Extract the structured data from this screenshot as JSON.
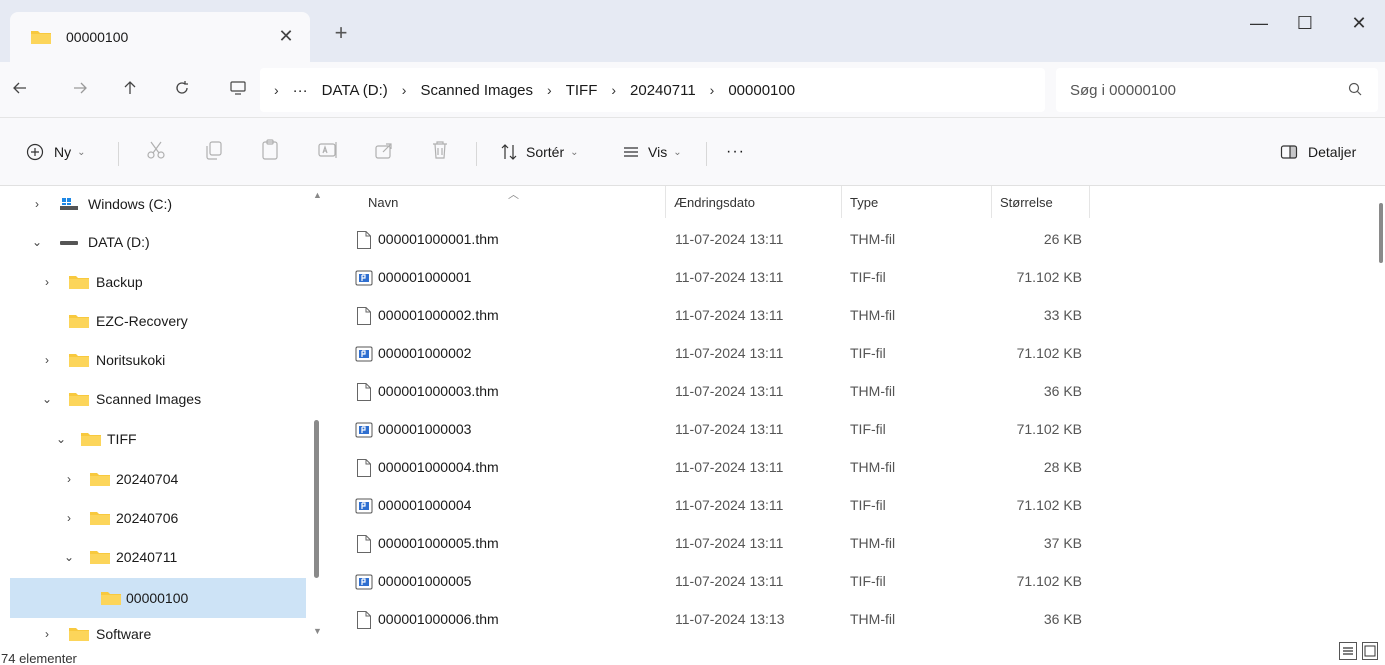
{
  "tab": {
    "title": "00000100",
    "close": "✕",
    "new": "+"
  },
  "window": {
    "minimize": "—",
    "maximize": "☐",
    "close": "✕"
  },
  "address": {
    "crumbs": [
      "DATA (D:)",
      "Scanned Images",
      "TIFF",
      "20240711",
      "00000100"
    ],
    "ellipsis": "···",
    "separator": "›"
  },
  "search": {
    "placeholder": "Søg i 00000100"
  },
  "commands": {
    "new_label": "Ny",
    "sort_label": "Sortér",
    "view_label": "Vis",
    "more_label": "···",
    "details_label": "Detaljer"
  },
  "nav": {
    "items": [
      {
        "label": "Windows (C:)",
        "chevron": "›"
      },
      {
        "label": "DATA (D:)",
        "chevron": "⌄"
      },
      {
        "label": "Backup",
        "chevron": "›"
      },
      {
        "label": "EZC-Recovery",
        "chevron": ""
      },
      {
        "label": "Noritsukoki",
        "chevron": "›"
      },
      {
        "label": "Scanned Images",
        "chevron": "⌄"
      },
      {
        "label": "TIFF",
        "chevron": "⌄"
      },
      {
        "label": "20240704",
        "chevron": "›"
      },
      {
        "label": "20240706",
        "chevron": "›"
      },
      {
        "label": "20240711",
        "chevron": "⌄"
      },
      {
        "label": "00000100",
        "chevron": ""
      },
      {
        "label": "Software",
        "chevron": "›"
      }
    ]
  },
  "columns": {
    "name": "Navn",
    "date": "Ændringsdato",
    "type": "Type",
    "size": "Størrelse"
  },
  "files": [
    {
      "name": "000001000001.thm",
      "date": "11-07-2024 13:11",
      "type": "THM-fil",
      "size": "26 KB",
      "icon": "file-icon"
    },
    {
      "name": "000001000001",
      "date": "11-07-2024 13:11",
      "type": "TIF-fil",
      "size": "71.102 KB",
      "icon": "image-icon"
    },
    {
      "name": "000001000002.thm",
      "date": "11-07-2024 13:11",
      "type": "THM-fil",
      "size": "33 KB",
      "icon": "file-icon"
    },
    {
      "name": "000001000002",
      "date": "11-07-2024 13:11",
      "type": "TIF-fil",
      "size": "71.102 KB",
      "icon": "image-icon"
    },
    {
      "name": "000001000003.thm",
      "date": "11-07-2024 13:11",
      "type": "THM-fil",
      "size": "36 KB",
      "icon": "file-icon"
    },
    {
      "name": "000001000003",
      "date": "11-07-2024 13:11",
      "type": "TIF-fil",
      "size": "71.102 KB",
      "icon": "image-icon"
    },
    {
      "name": "000001000004.thm",
      "date": "11-07-2024 13:11",
      "type": "THM-fil",
      "size": "28 KB",
      "icon": "file-icon"
    },
    {
      "name": "000001000004",
      "date": "11-07-2024 13:11",
      "type": "TIF-fil",
      "size": "71.102 KB",
      "icon": "image-icon"
    },
    {
      "name": "000001000005.thm",
      "date": "11-07-2024 13:11",
      "type": "THM-fil",
      "size": "37 KB",
      "icon": "file-icon"
    },
    {
      "name": "000001000005",
      "date": "11-07-2024 13:11",
      "type": "TIF-fil",
      "size": "71.102 KB",
      "icon": "image-icon"
    },
    {
      "name": "000001000006.thm",
      "date": "11-07-2024 13:13",
      "type": "THM-fil",
      "size": "36 KB",
      "icon": "file-icon"
    }
  ],
  "status": {
    "count": "74 elementer"
  },
  "colors": {
    "folder": "#f8c93e",
    "selected": "#cde3f6",
    "titlebar": "#e6eaf3",
    "toolbar": "#f9f9fb"
  }
}
